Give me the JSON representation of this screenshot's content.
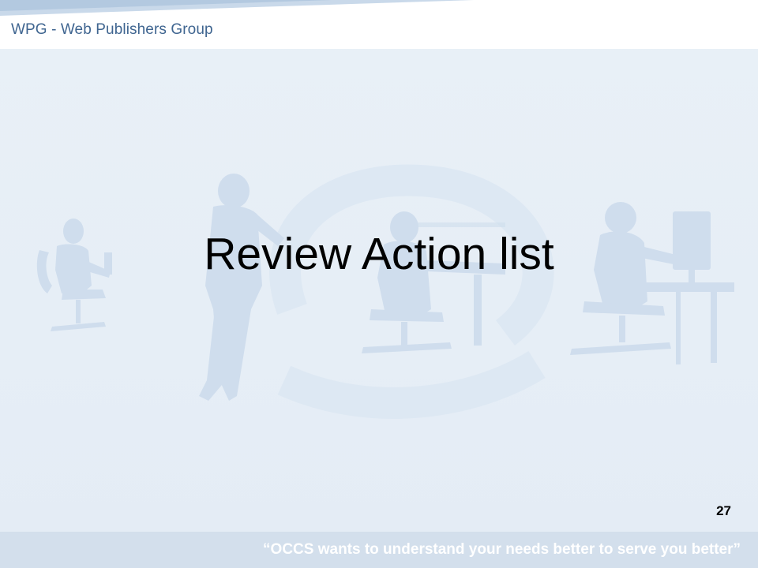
{
  "header": {
    "title": "WPG - Web Publishers Group"
  },
  "slide": {
    "title": "Review Action list",
    "page_number": "27"
  },
  "footer": {
    "quote": "“OCCS wants to understand your needs better to serve you better”"
  },
  "colors": {
    "header_text": "#3f6590",
    "background": "#e7eff7",
    "footer_band": "#d3dfec",
    "silhouette": "#cddcec"
  }
}
